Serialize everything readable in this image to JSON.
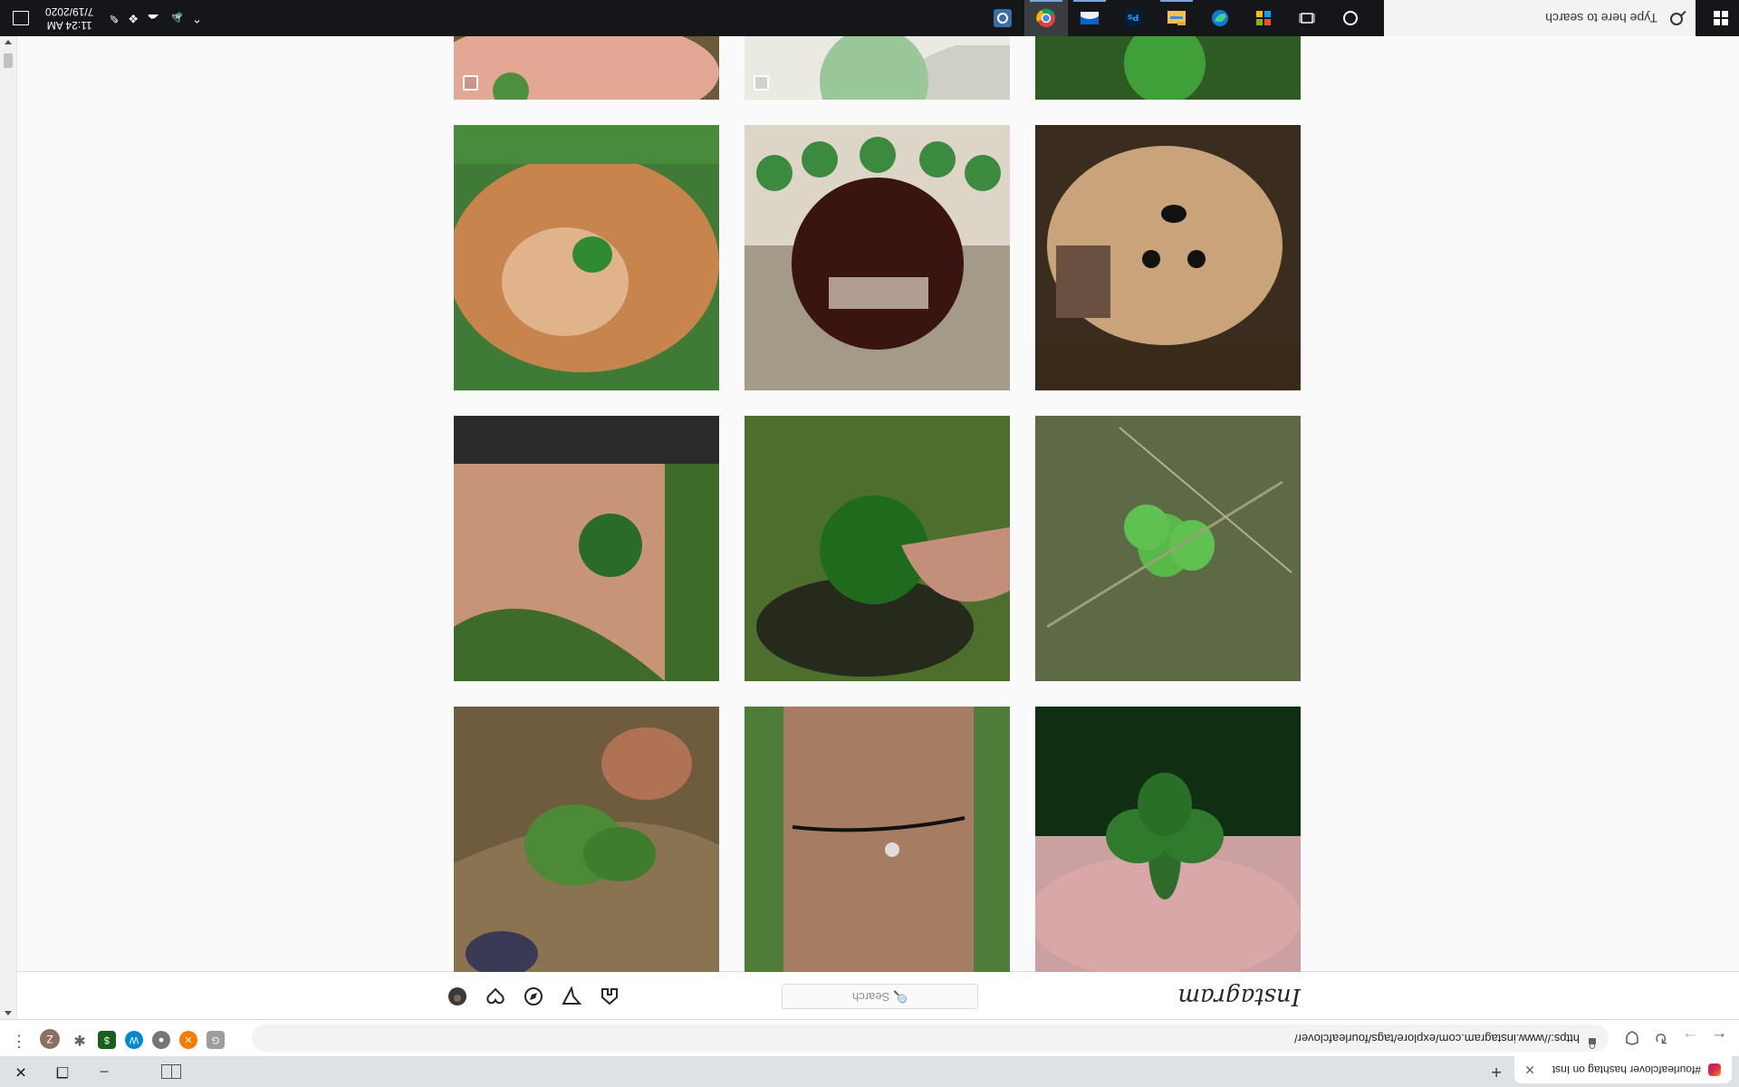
{
  "browser": {
    "tab_title": "#fourleafclover hashtag on Inst",
    "new_tab_symbol": "+",
    "url": "https://www.instagram.com/explore/tags/fourleafclover/",
    "profile_initial": "Z",
    "window_controls": [
      "–",
      "❐",
      "✕"
    ]
  },
  "instagram": {
    "logo": "Instagram",
    "search_placeholder": "🔍 Search",
    "nav_icons": [
      "home-icon",
      "direct-icon",
      "explore-icon",
      "activity-icon",
      "profile-avatar"
    ]
  },
  "grid_posts": [
    {
      "subject": "hand holding clover",
      "multi": true
    },
    {
      "subject": "clover in glass",
      "multi": true
    },
    {
      "subject": "clover in grass",
      "multi": false
    },
    {
      "subject": "small dog",
      "multi": true
    },
    {
      "subject": "glass ball with clovers",
      "multi": false
    },
    {
      "subject": "clover on cat",
      "multi": false
    },
    {
      "subject": "clover in weeds",
      "multi": false
    },
    {
      "subject": "clover held by fingers",
      "multi": false
    },
    {
      "subject": "clover in hand with freckles",
      "multi": false
    },
    {
      "subject": "clover held close",
      "multi": false
    },
    {
      "subject": "clover bracelet",
      "multi": false
    },
    {
      "subject": "clover with sneakers",
      "multi": false
    }
  ],
  "taskbar": {
    "search_text": "Type here to search",
    "time": "11:24 AM",
    "date": "7/19/2020",
    "apps": [
      "cortana-icon",
      "task-view-icon",
      "store-icon",
      "edge-icon",
      "file-explorer-icon",
      "photoshop-icon",
      "mail-icon",
      "chrome-icon",
      "settings-app-icon"
    ],
    "ps_label": "Ps"
  },
  "colors": {
    "instagram_accent": "#c13584",
    "taskbar": "#14161a"
  }
}
